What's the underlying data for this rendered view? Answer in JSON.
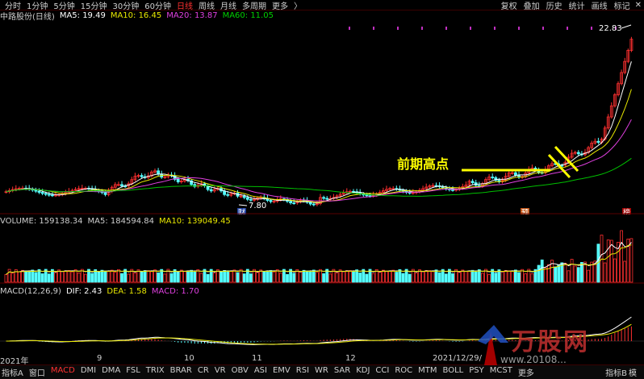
{
  "toolbar": {
    "timeframes": [
      "分时",
      "1分钟",
      "5分钟",
      "15分钟",
      "30分钟",
      "60分钟",
      "日线",
      "周线",
      "月线",
      "多周期",
      "更多"
    ],
    "active_timeframe": "日线",
    "more_arrow": "〉",
    "right_menu": [
      "复权",
      "叠加",
      "历史",
      "统计",
      "画线",
      "标记"
    ]
  },
  "price_panel": {
    "stock_label": "中路股份(日线)",
    "ma5": "MA5: 19.49",
    "ma10": "MA10: 16.45",
    "ma20": "MA20: 13.87",
    "ma60": "MA60: 11.05",
    "high_label": "22.83",
    "low_label": "7.80",
    "annotation": "前期高点",
    "marker_cai": "财",
    "marker_yu": "预",
    "marker_bang": "榜"
  },
  "volume_panel": {
    "volume": "VOLUME: 159138.34",
    "ma5": "MA5: 184594.84",
    "ma10": "MA10: 139049.45"
  },
  "macd_panel": {
    "title": "MACD(12,26,9)",
    "dif": "DIF: 2.43",
    "dea": "DEA: 1.58",
    "macd": "MACD: 1.70"
  },
  "x_axis": {
    "labels": [
      "2021年",
      "9",
      "10",
      "11",
      "12",
      "2021/12/29/"
    ]
  },
  "bottom_bar": {
    "prefix": "指标A",
    "window": "窗口",
    "indicators": [
      "MACD",
      "DMI",
      "DMA",
      "FSL",
      "TRIX",
      "BRAR",
      "CR",
      "VR",
      "OBV",
      "ASI",
      "EMV",
      "RSI",
      "WR",
      "SAR",
      "KDJ",
      "CCI",
      "ROC",
      "MTM",
      "BOLL",
      "PSY",
      "MCST",
      "更多"
    ],
    "active_indicator": "MACD",
    "right_label": "指标B",
    "right_extra": "模"
  },
  "watermark": {
    "text": "万股网",
    "url": "www.20108..."
  },
  "colors": {
    "ma5": "#ffffff",
    "ma10": "#e8e800",
    "ma20": "#e040e0",
    "ma60": "#00c000",
    "up": "#ff3030",
    "down": "#54ffff",
    "annotation": "#ffff00"
  },
  "chart_data": {
    "type": "candlestick",
    "price_range_visible": [
      7.8,
      22.83
    ],
    "high": 22.83,
    "low": 7.8,
    "moving_averages": {
      "MA5": 19.49,
      "MA10": 16.45,
      "MA20": 13.87,
      "MA60": 11.05
    },
    "volume": {
      "VOLUME": 159138.34,
      "MA5": 184594.84,
      "MA10": 139049.45
    },
    "macd": {
      "DIF": 2.43,
      "DEA": 1.58,
      "MACD": 1.7
    }
  }
}
